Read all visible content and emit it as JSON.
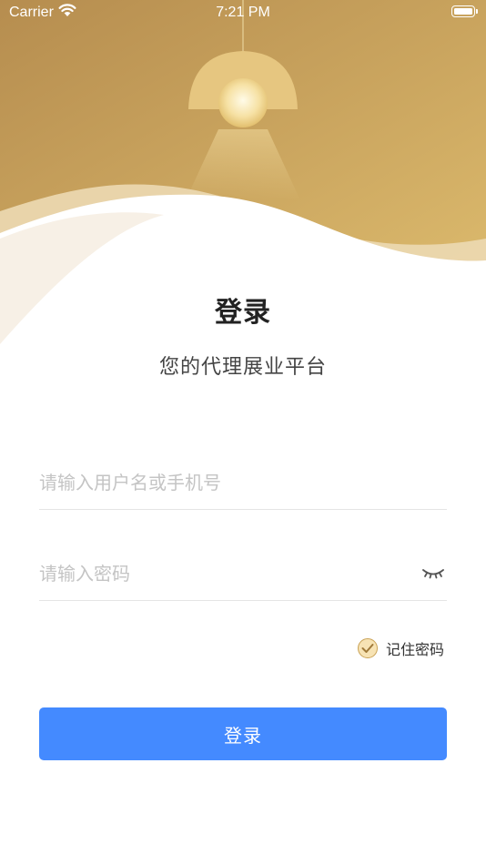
{
  "status_bar": {
    "carrier": "Carrier",
    "time": "7:21 PM"
  },
  "login": {
    "title": "登录",
    "subtitle": "您的代理展业平台",
    "username": {
      "value": "",
      "placeholder": "请输入用户名或手机号"
    },
    "password": {
      "value": "",
      "placeholder": "请输入密码"
    },
    "remember_label": "记住密码",
    "remember_checked": true,
    "submit_label": "登录"
  },
  "colors": {
    "accent": "#448aff",
    "gold": "#d4aa5e",
    "checkbox_fill": "#f7e3b4"
  },
  "icons": [
    "wifi-icon",
    "battery-icon",
    "lamp-illustration",
    "password-visibility-icon",
    "checkmark-icon"
  ]
}
